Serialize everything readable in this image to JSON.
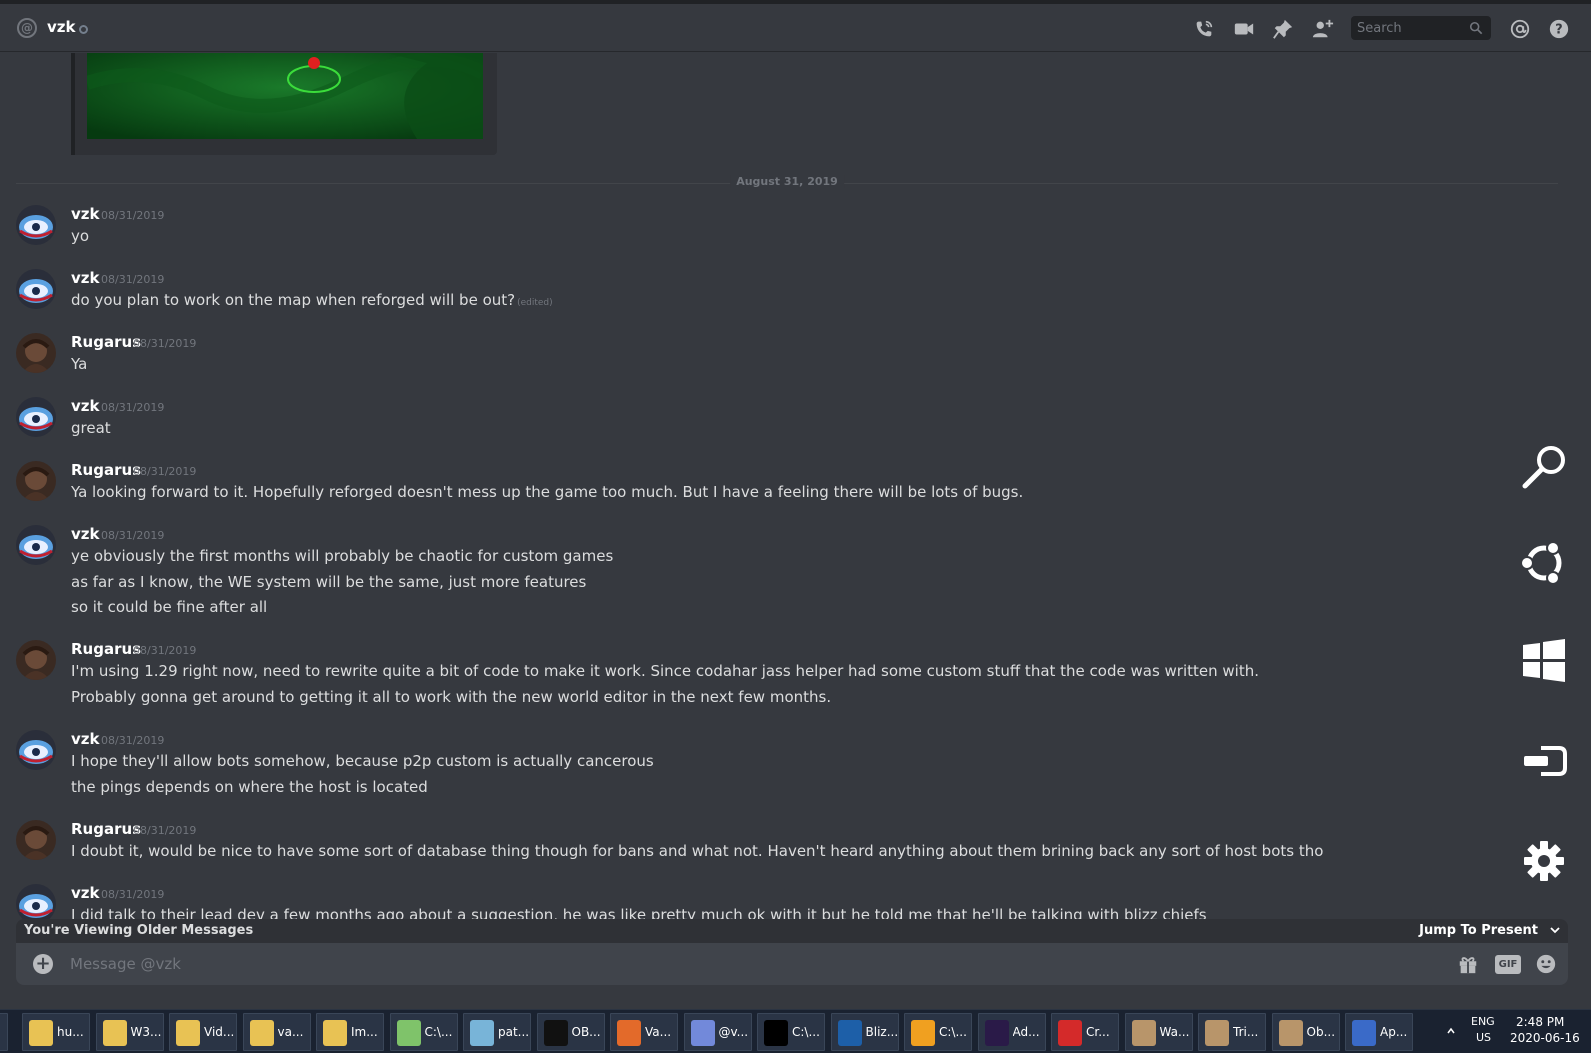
{
  "header": {
    "title": "vzk",
    "search_placeholder": "Search"
  },
  "date_divider": "August 31, 2019",
  "messages": [
    {
      "user": "vzk",
      "time": "08/31/2019",
      "lines": [
        "yo"
      ]
    },
    {
      "user": "vzk",
      "time": "08/31/2019",
      "lines": [
        "do you plan to work on the map when reforged will be out?"
      ],
      "edited": "(edited)"
    },
    {
      "user": "Rugarus",
      "time": "08/31/2019",
      "lines": [
        "Ya"
      ]
    },
    {
      "user": "vzk",
      "time": "08/31/2019",
      "lines": [
        "great"
      ]
    },
    {
      "user": "Rugarus",
      "time": "08/31/2019",
      "lines": [
        "Ya looking forward to it. Hopefully reforged doesn't mess up the game too much. But I have a feeling there will be lots of bugs."
      ]
    },
    {
      "user": "vzk",
      "time": "08/31/2019",
      "lines": [
        "ye obviously the first months will probably be chaotic for custom games",
        "as far as I know, the WE system will be the same, just more features",
        "so it could be fine after all"
      ]
    },
    {
      "user": "Rugarus",
      "time": "08/31/2019",
      "lines": [
        "I'm using 1.29 right now, need to rewrite quite a bit of code to make it work. Since codahar jass helper had some custom stuff that the code was written with.",
        "Probably gonna get around to getting it all to work with the new world editor in the next few months."
      ]
    },
    {
      "user": "vzk",
      "time": "08/31/2019",
      "lines": [
        "I hope they'll allow bots somehow, because p2p custom is actually cancerous",
        "the pings depends on where the host is located"
      ]
    },
    {
      "user": "Rugarus",
      "time": "08/31/2019",
      "lines": [
        "I doubt it, would be nice to have some sort of database thing though for bans and what not. Haven't heard anything about them brining back any sort of host bots tho"
      ]
    },
    {
      "user": "vzk",
      "time": "08/31/2019",
      "lines": [
        "I did talk to their lead dev a few months ago about a suggestion, he was like pretty much ok with it but he told me that he'll be talking with blizz chiefs"
      ]
    }
  ],
  "older_bar": {
    "notice": "You're Viewing Older Messages",
    "jump": "Jump To Present"
  },
  "composer": {
    "placeholder": "Message @vzk",
    "gif": "GIF"
  },
  "taskbar": {
    "items": [
      {
        "label": "hu...",
        "icon": "folder-icon"
      },
      {
        "label": "W3...",
        "icon": "folder-icon"
      },
      {
        "label": "Vid...",
        "icon": "folder-icon"
      },
      {
        "label": "va...",
        "icon": "folder-icon"
      },
      {
        "label": "Im...",
        "icon": "folder-icon"
      },
      {
        "label": "C:\\...",
        "icon": "notepad-icon"
      },
      {
        "label": "pat...",
        "icon": "paint-icon"
      },
      {
        "label": "OB...",
        "icon": "obs-icon"
      },
      {
        "label": "Va...",
        "icon": "firefox-icon"
      },
      {
        "label": "@v...",
        "icon": "discord-icon"
      },
      {
        "label": "C:\\...",
        "icon": "terminal-icon"
      },
      {
        "label": "Bliz...",
        "icon": "battlenet-icon"
      },
      {
        "label": "C:\\...",
        "icon": "binoculars-icon"
      },
      {
        "label": "Ad...",
        "icon": "after-effects-icon"
      },
      {
        "label": "Cr...",
        "icon": "creative-cloud-icon"
      },
      {
        "label": "Wa...",
        "icon": "worldedit-icon"
      },
      {
        "label": "Tri...",
        "icon": "worldedit-icon"
      },
      {
        "label": "Ob...",
        "icon": "worldedit-icon"
      },
      {
        "label": "Ap...",
        "icon": "app-icon"
      }
    ],
    "lang_top": "ENG",
    "lang_bottom": "US",
    "time": "2:48 PM",
    "date": "2020-06-16"
  }
}
